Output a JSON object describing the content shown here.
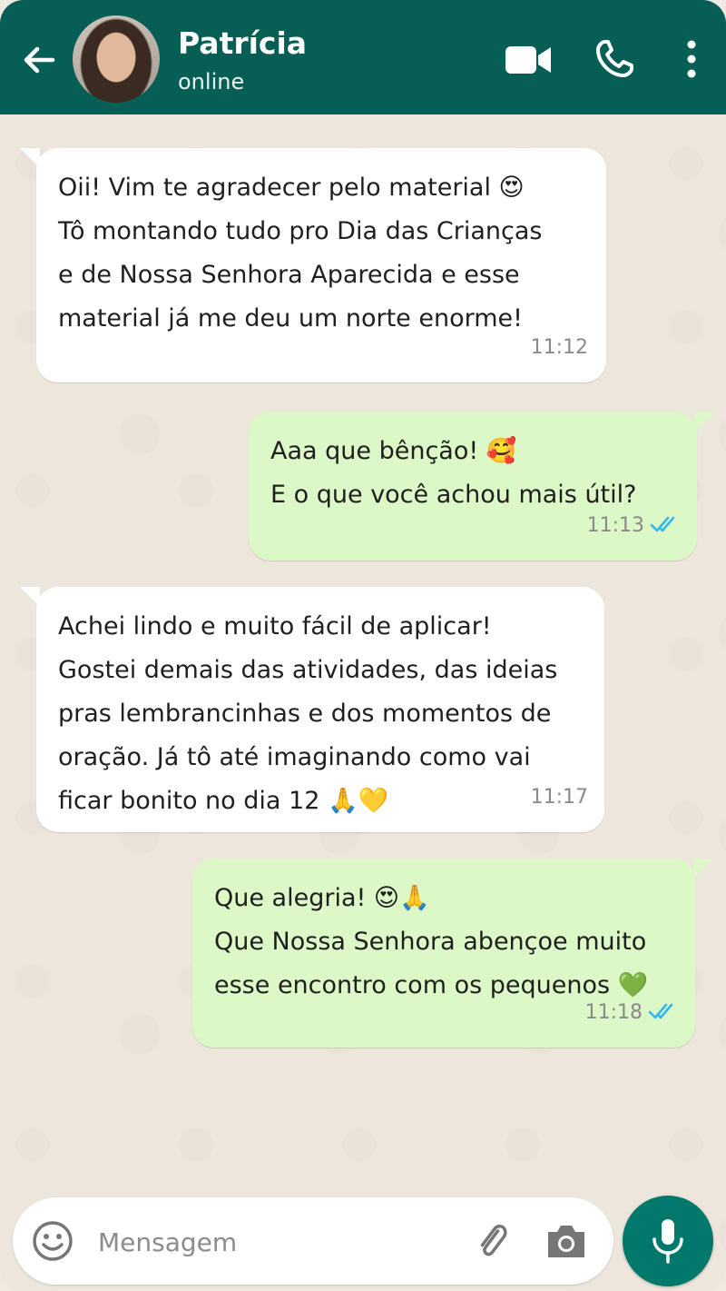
{
  "header": {
    "contact_name": "Patrícia",
    "status": "online"
  },
  "messages": [
    {
      "direction": "incoming",
      "lines": [
        "Oii! Vim te agradecer pelo material 😍",
        "Tô montando tudo pro Dia das Crianças",
        "e de Nossa Senhora Aparecida e esse",
        "material já me deu um norte enorme!"
      ],
      "time": "11:12"
    },
    {
      "direction": "outgoing",
      "lines": [
        "Aaa que bênção! 🥰",
        "E o que você achou mais útil?"
      ],
      "time": "11:13",
      "status": "read"
    },
    {
      "direction": "incoming",
      "lines": [
        "Achei lindo e muito fácil de aplicar!",
        "Gostei demais das atividades, das ideias",
        "pras lembrancinhas e dos momentos de",
        "oração. Já tô até imaginando como vai",
        "ficar bonito no dia 12 🙏💛"
      ],
      "time": "11:17"
    },
    {
      "direction": "outgoing",
      "lines": [
        "Que alegria! 😍🙏",
        "Que Nossa Senhora abençoe muito",
        "esse encontro com os pequenos 💚"
      ],
      "time": "11:18",
      "status": "read"
    }
  ],
  "composer": {
    "placeholder": "Mensagem"
  },
  "colors": {
    "header": "#075e54",
    "outgoing_bubble": "#dcf8c6",
    "incoming_bubble": "#ffffff",
    "read_ticks": "#34b7f1",
    "mic_button": "#00796b"
  }
}
